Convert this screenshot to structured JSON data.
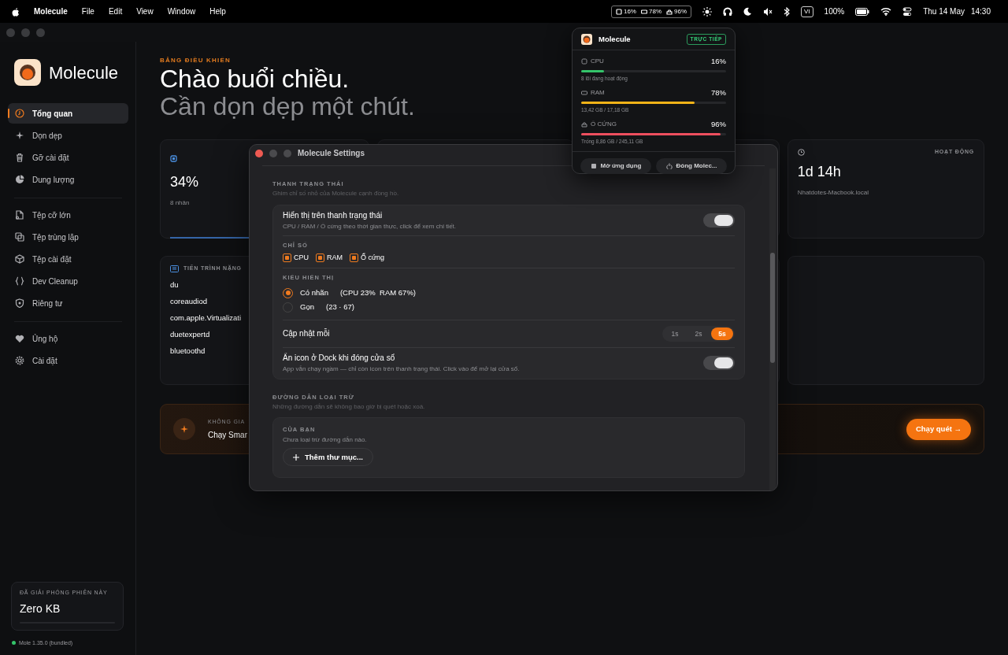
{
  "menubar": {
    "app": "Molecule",
    "menus": [
      "File",
      "Edit",
      "View",
      "Window",
      "Help"
    ],
    "status_item": [
      {
        "value": "16%"
      },
      {
        "value": "78%"
      },
      {
        "value": "96%"
      }
    ],
    "input_source": "VI",
    "battery": "100%",
    "date": "Thu 14 May",
    "time": "14:30"
  },
  "sidebar": {
    "app_name": "Molecule",
    "groups": [
      [
        {
          "label": "Tổng quan",
          "selected": true
        },
        {
          "label": "Dọn dẹp",
          "selected": false
        },
        {
          "label": "Gỡ cài đặt",
          "selected": false
        },
        {
          "label": "Dung lượng",
          "selected": false
        }
      ],
      [
        {
          "label": "Tệp cỡ lớn",
          "selected": false
        },
        {
          "label": "Tệp trùng lặp",
          "selected": false
        },
        {
          "label": "Tệp cài đặt",
          "selected": false
        },
        {
          "label": "Dev Cleanup",
          "selected": false
        },
        {
          "label": "Riêng tư",
          "selected": false
        }
      ],
      [
        {
          "label": "Ủng hộ",
          "selected": false
        },
        {
          "label": "Cài đặt",
          "selected": false
        }
      ]
    ],
    "session": {
      "label": "ĐÃ GIẢI PHÓNG PHIÊN NÀY",
      "value": "Zero KB"
    },
    "version": "Mole 1.35.0 (bundled)"
  },
  "dashboard": {
    "eyebrow": "BẢNG ĐIỀU KHIỂN",
    "greeting": "Chào buổi chiều.",
    "subtitle": "Cần dọn dẹp một chút.",
    "cpu_card": {
      "value": "34%",
      "caption": "8 nhân"
    },
    "uptime_card": {
      "label": "HOẠT ĐỘNG",
      "value": "1d 14h",
      "caption": "Nhatdotes-Macbook.local"
    },
    "processes": {
      "title": "TIẾN TRÌNH NẶNG",
      "rows": [
        "du",
        "coreaudiod",
        "com.apple.Virtualizati",
        "duetexpertd",
        "bluetoothd"
      ]
    },
    "banner": {
      "label": "KHÔNG GIA",
      "text": "Chạy Smar",
      "button": "Chạy quét →"
    }
  },
  "settings": {
    "title": "Molecule Settings",
    "status_bar": {
      "title": "THANH TRẠNG THÁI",
      "subtitle": "Ghim chỉ số nhỏ của Molecule cạnh đồng hồ.",
      "show": {
        "label": "Hiển thị trên thanh trạng thái",
        "description": "CPU / RAM / Ổ cứng theo thời gian thực, click để xem chi tiết.",
        "on": true
      },
      "metrics": {
        "label": "CHỈ SỐ",
        "items": [
          {
            "label": "CPU",
            "checked": true
          },
          {
            "label": "RAM",
            "checked": true
          },
          {
            "label": "Ổ cứng",
            "checked": true
          }
        ]
      },
      "display_style": {
        "label": "KIỂU HIỂN THỊ",
        "options": [
          {
            "label": "Có nhãn",
            "sample": "(CPU 23%  RAM 67%)",
            "selected": true
          },
          {
            "label": "Gọn",
            "sample": "(23 · 67)",
            "selected": false
          }
        ]
      },
      "refresh": {
        "label": "Cập nhật mỗi",
        "options": [
          {
            "label": "1s",
            "selected": false
          },
          {
            "label": "2s",
            "selected": false
          },
          {
            "label": "5s",
            "selected": true
          }
        ]
      },
      "hide_dock": {
        "label": "Ẩn icon ở Dock khi đóng cửa sổ",
        "description": "App vẫn chạy ngầm — chỉ còn icon trên thanh trạng thái. Click vào để mở lại cửa sổ.",
        "on": true
      }
    },
    "exclusions": {
      "title": "ĐƯỜNG DẪN LOẠI TRỪ",
      "subtitle": "Những đường dẫn sẽ không bao giờ bị quét hoặc xoá.",
      "yours_label": "CỦA BẠN",
      "empty": "Chưa loại trừ đường dẫn nào.",
      "add_button": "Thêm thư mục..."
    }
  },
  "popover": {
    "app": "Molecule",
    "badge": "TRỰC TIẾP",
    "metrics": [
      {
        "label": "CPU",
        "value": "16%",
        "level": 0.16,
        "caption": "8 lõi đang hoạt động",
        "color": "#34c46a"
      },
      {
        "label": "RAM",
        "value": "78%",
        "level": 0.78,
        "caption": "13,42 GB / 17,18 GB",
        "color": "#f2b318"
      },
      {
        "label": "Ổ CỨNG",
        "value": "96%",
        "level": 0.96,
        "caption": "Trống 8,86 GB / 245,11 GB",
        "color": "#ee4f5e"
      }
    ],
    "buttons": [
      "Mở ứng dụng",
      "Đóng Molec..."
    ]
  }
}
